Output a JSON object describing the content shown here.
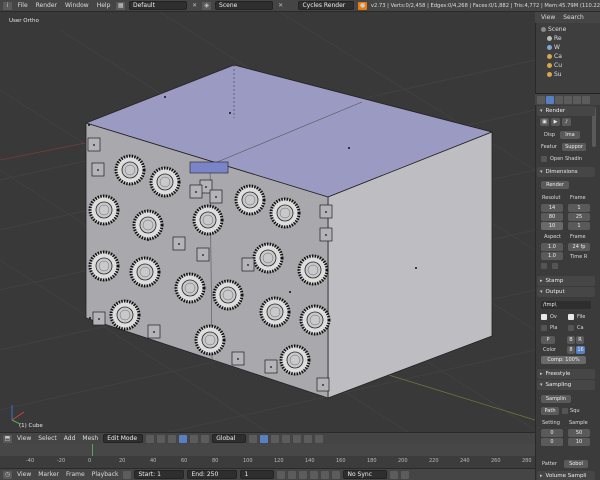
{
  "topbar": {
    "menus": [
      "File",
      "Render",
      "Window",
      "Help"
    ],
    "screen_layout": "Default",
    "scene": "Scene",
    "engine": "Cycles Render",
    "stats": "v2.73 | Verts:0/2,458 | Edges:0/4,268 | Faces:0/1,882 | Tris:4,772 | Mem:45.79M (110.22"
  },
  "viewport": {
    "view_label": "User Ortho",
    "object_label": "(1) Cube"
  },
  "view3d_header": {
    "menus": [
      "View",
      "Select",
      "Add",
      "Mesh"
    ],
    "mode": "Edit Mode",
    "orientation": "Global"
  },
  "timeline": {
    "ruler_ticks": [
      "-40",
      "-20",
      "0",
      "20",
      "40",
      "60",
      "80",
      "100",
      "120",
      "140",
      "160",
      "180",
      "200",
      "220",
      "240",
      "260",
      "280"
    ],
    "menus": [
      "View",
      "Marker",
      "Frame",
      "Playback"
    ],
    "start_label": "Start:",
    "start": "1",
    "end_label": "End:",
    "end": "250",
    "current": "1",
    "sync": "No Sync"
  },
  "outliner": {
    "header": [
      "View",
      "Search"
    ],
    "items": [
      "Scene",
      "Re",
      "W",
      "Ca",
      "Cu",
      "Su"
    ]
  },
  "properties": {
    "render_section": "Render",
    "disp_label": "Disp",
    "disp_value": "Ima",
    "feature_label": "Featur",
    "feature_value": "Suppor",
    "open_shading": "Open Shadin",
    "dimensions_section": "Dimensions",
    "render_preset": "Render",
    "resolution_label": "Resolut",
    "frame_label": "Frame",
    "res_x": "14",
    "res_y": "80",
    "res_pct": "10",
    "frame_start": "1",
    "frame_end": "25",
    "frame_step": "1",
    "aspect_label": "Aspect",
    "frame_rate_label": "Frame",
    "aspect_x": "1.0",
    "aspect_y": "1.0",
    "fps": "24 fp",
    "time_label": "Time R",
    "stamp_section": "Stamp",
    "output_section": "Output",
    "output_path": "/tmp\\",
    "ov_label": "Ov",
    "file_label": "File",
    "pla_label": "Pla",
    "ca_label": "Ca",
    "format_short": "P",
    "bw": "B",
    "r": "R",
    "color_label": "Color",
    "color_depth_a": "8",
    "color_depth_b": "16",
    "compression": "Comp: 100%",
    "freestyle_section": "Freestyle",
    "sampling_section": "Sampling",
    "sampling_preset": "Samplin",
    "path_label": "Path",
    "squ_label": "Squ",
    "settings_label": "Setting",
    "samples_label": "Sample",
    "seed": "0",
    "render_samples": "50",
    "seed2": "0",
    "preview_samples": "10",
    "pattern_label": "Patter",
    "pattern_value": "Sobol",
    "volume_section": "Volume Sampli"
  }
}
